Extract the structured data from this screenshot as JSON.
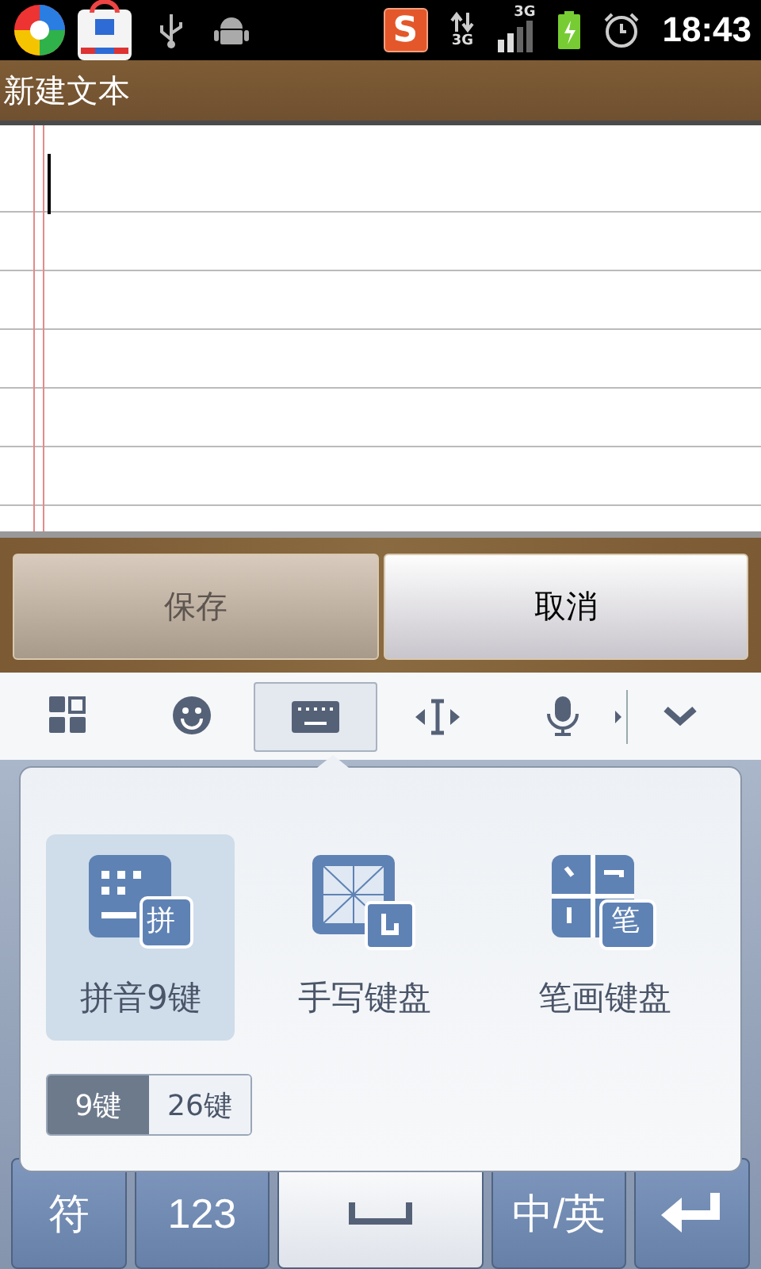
{
  "status_bar": {
    "ime_badge": "S",
    "data_label": "3G",
    "signal_label": "3G",
    "time": "18:43"
  },
  "title": "新建文本",
  "note": {
    "cursor": true
  },
  "actions": [
    {
      "label": "保存",
      "disabled": true
    },
    {
      "label": "取消",
      "disabled": false
    }
  ],
  "toolbar": [
    {
      "kind": "grid",
      "selected": false
    },
    {
      "kind": "emoji",
      "selected": false
    },
    {
      "kind": "keyboard",
      "selected": true
    },
    {
      "kind": "cursor",
      "selected": false
    },
    {
      "kind": "mic",
      "selected": false
    },
    {
      "kind": "collapse",
      "selected": false
    }
  ],
  "input_modes": [
    {
      "kind": "pinyin",
      "label": "拼音9键",
      "badge": "拼",
      "selected": true
    },
    {
      "kind": "handwriting",
      "label": "手写键盘",
      "selected": false
    },
    {
      "kind": "stroke",
      "label": "笔画键盘",
      "badge": "笔",
      "selected": false
    }
  ],
  "layout_toggle": [
    {
      "label": "9键",
      "selected": true
    },
    {
      "label": "26键",
      "selected": false
    }
  ],
  "keys": [
    {
      "kind": "text",
      "label": "符"
    },
    {
      "kind": "text",
      "label": "123"
    },
    {
      "kind": "space"
    },
    {
      "kind": "text",
      "label": "中/英"
    },
    {
      "kind": "enter"
    }
  ]
}
